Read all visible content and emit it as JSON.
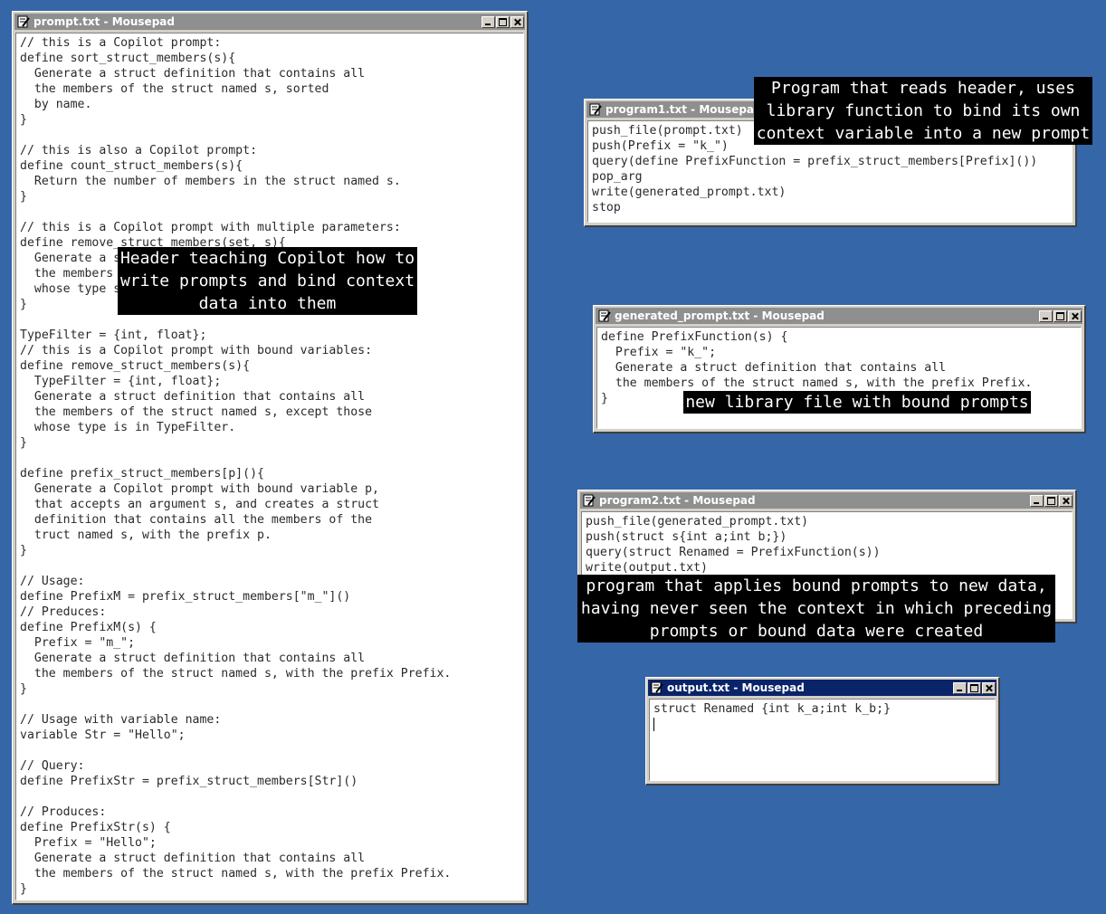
{
  "windows": {
    "prompt": {
      "title": "prompt.txt - Mousepad",
      "content": "// this is a Copilot prompt:\ndefine sort_struct_members(s){\n  Generate a struct definition that contains all\n  the members of the struct named s, sorted\n  by name.\n}\n\n// this is also a Copilot prompt:\ndefine count_struct_members(s){\n  Return the number of members in the struct named s.\n}\n\n// this is a Copilot prompt with multiple parameters:\ndefine remove_struct_members(set, s){\n  Generate a s\n  the members\n  whose type s\n}\n\nTypeFilter = {int, float};\n// this is a Copilot prompt with bound variables:\ndefine remove_struct_members(s){\n  TypeFilter = {int, float};\n  Generate a struct definition that contains all\n  the members of the struct named s, except those\n  whose type is in TypeFilter.\n}\n\ndefine prefix_struct_members[p](){\n  Generate a Copilot prompt with bound variable p,\n  that accepts an argument s, and creates a struct\n  definition that contains all the members of the\n  truct named s, with the prefix p.\n}\n\n// Usage:\ndefine PrefixM = prefix_struct_members[\"m_\"]()\n// Preduces:\ndefine PrefixM(s) {\n  Prefix = \"m_\";\n  Generate a struct definition that contains all\n  the members of the struct named s, with the prefix Prefix.\n}\n\n// Usage with variable name:\nvariable Str = \"Hello\";\n\n// Query:\ndefine PrefixStr = prefix_struct_members[Str]()\n\n// Produces:\ndefine PrefixStr(s) {\n  Prefix = \"Hello\";\n  Generate a struct definition that contains all\n  the members of the struct named s, with the prefix Prefix.\n}"
    },
    "program1": {
      "title": "program1.txt - Mousepad",
      "content": "push_file(prompt.txt)\npush(Prefix = \"k_\")\nquery(define PrefixFunction = prefix_struct_members[Prefix]())\npop_arg\nwrite(generated_prompt.txt)\nstop"
    },
    "generated": {
      "title": "generated_prompt.txt - Mousepad",
      "content": "define PrefixFunction(s) {\n  Prefix = \"k_\";\n  Generate a struct definition that contains all\n  the members of the struct named s, with the prefix Prefix.\n}"
    },
    "program2": {
      "title": "program2.txt - Mousepad",
      "content": "push_file(generated_prompt.txt)\npush(struct s{int a;int b;})\nquery(struct Renamed = PrefixFunction(s))\nwrite(output.txt)"
    },
    "output": {
      "title": "output.txt - Mousepad",
      "content": "struct Renamed {int k_a;int k_b;}"
    }
  },
  "labels": {
    "header": "Header teaching Copilot how to\nwrite prompts and bind context\ndata into them",
    "program1": "Program that reads header, uses\nlibrary function to bind its own\ncontext variable into a new prompt",
    "generated": "new library file with bound prompts",
    "program2": "program that applies bound prompts to new data,\nhaving never seen the context in which preceding\nprompts or bound data were created"
  },
  "colors": {
    "desktop": "#3566a8",
    "active_title": "#0a246a",
    "inactive_title": "#8f8f8f",
    "label_bg": "#000000"
  },
  "icons": [
    "notepad-icon",
    "minimize-icon",
    "maximize-icon",
    "close-icon"
  ]
}
